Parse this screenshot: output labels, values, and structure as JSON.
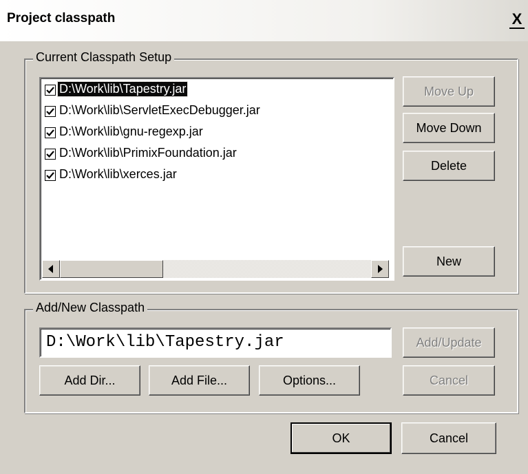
{
  "window": {
    "title": "Project classpath",
    "close_label": "X"
  },
  "classpath_group": {
    "legend": "Current Classpath Setup",
    "items": [
      {
        "label": "D:\\Work\\lib\\Tapestry.jar",
        "checked": true,
        "selected": true
      },
      {
        "label": "D:\\Work\\lib\\ServletExecDebugger.jar",
        "checked": true,
        "selected": false
      },
      {
        "label": "D:\\Work\\lib\\gnu-regexp.jar",
        "checked": true,
        "selected": false
      },
      {
        "label": "D:\\Work\\lib\\PrimixFoundation.jar",
        "checked": true,
        "selected": false
      },
      {
        "label": "D:\\Work\\lib\\xerces.jar",
        "checked": true,
        "selected": false
      }
    ],
    "buttons": {
      "move_up": "Move Up",
      "move_down": "Move Down",
      "delete": "Delete",
      "new": "New"
    }
  },
  "add_group": {
    "legend": "Add/New Classpath",
    "path_value": "D:\\Work\\lib\\Tapestry.jar",
    "buttons": {
      "add_update": "Add/Update",
      "add_dir": "Add Dir...",
      "add_file": "Add File...",
      "options": "Options...",
      "cancel": "Cancel"
    }
  },
  "footer": {
    "ok": "OK",
    "cancel": "Cancel"
  }
}
